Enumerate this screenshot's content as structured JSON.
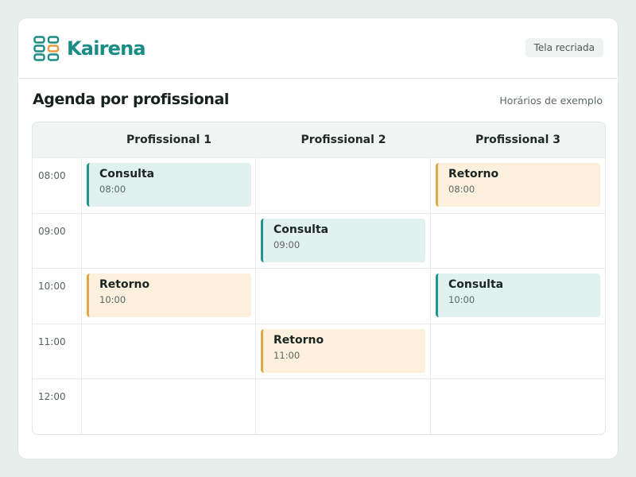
{
  "app": {
    "name": "Kairena",
    "badge": "Tela recriada"
  },
  "colors": {
    "brand": "#1a8c86",
    "consulta_accent": "#20958d",
    "consulta_bg": "#e1f1ef",
    "retorno_accent": "#e0a647",
    "retorno_bg": "#fdf0dc"
  },
  "page": {
    "title": "Agenda por profissional",
    "note": "Horários de exemplo"
  },
  "schedule": {
    "columns": [
      "Profissional 1",
      "Profissional 2",
      "Profissional 3"
    ],
    "rows": [
      {
        "time": "08:00",
        "slots": [
          {
            "type": "consulta",
            "title": "Consulta",
            "time": "08:00"
          },
          null,
          {
            "type": "retorno",
            "title": "Retorno",
            "time": "08:00"
          }
        ]
      },
      {
        "time": "09:00",
        "slots": [
          null,
          {
            "type": "consulta",
            "title": "Consulta",
            "time": "09:00"
          },
          null
        ]
      },
      {
        "time": "10:00",
        "slots": [
          {
            "type": "retorno",
            "title": "Retorno",
            "time": "10:00"
          },
          null,
          {
            "type": "consulta",
            "title": "Consulta",
            "time": "10:00"
          }
        ]
      },
      {
        "time": "11:00",
        "slots": [
          null,
          {
            "type": "retorno",
            "title": "Retorno",
            "time": "11:00"
          },
          null
        ]
      },
      {
        "time": "12:00",
        "slots": [
          null,
          null,
          null
        ]
      }
    ]
  }
}
